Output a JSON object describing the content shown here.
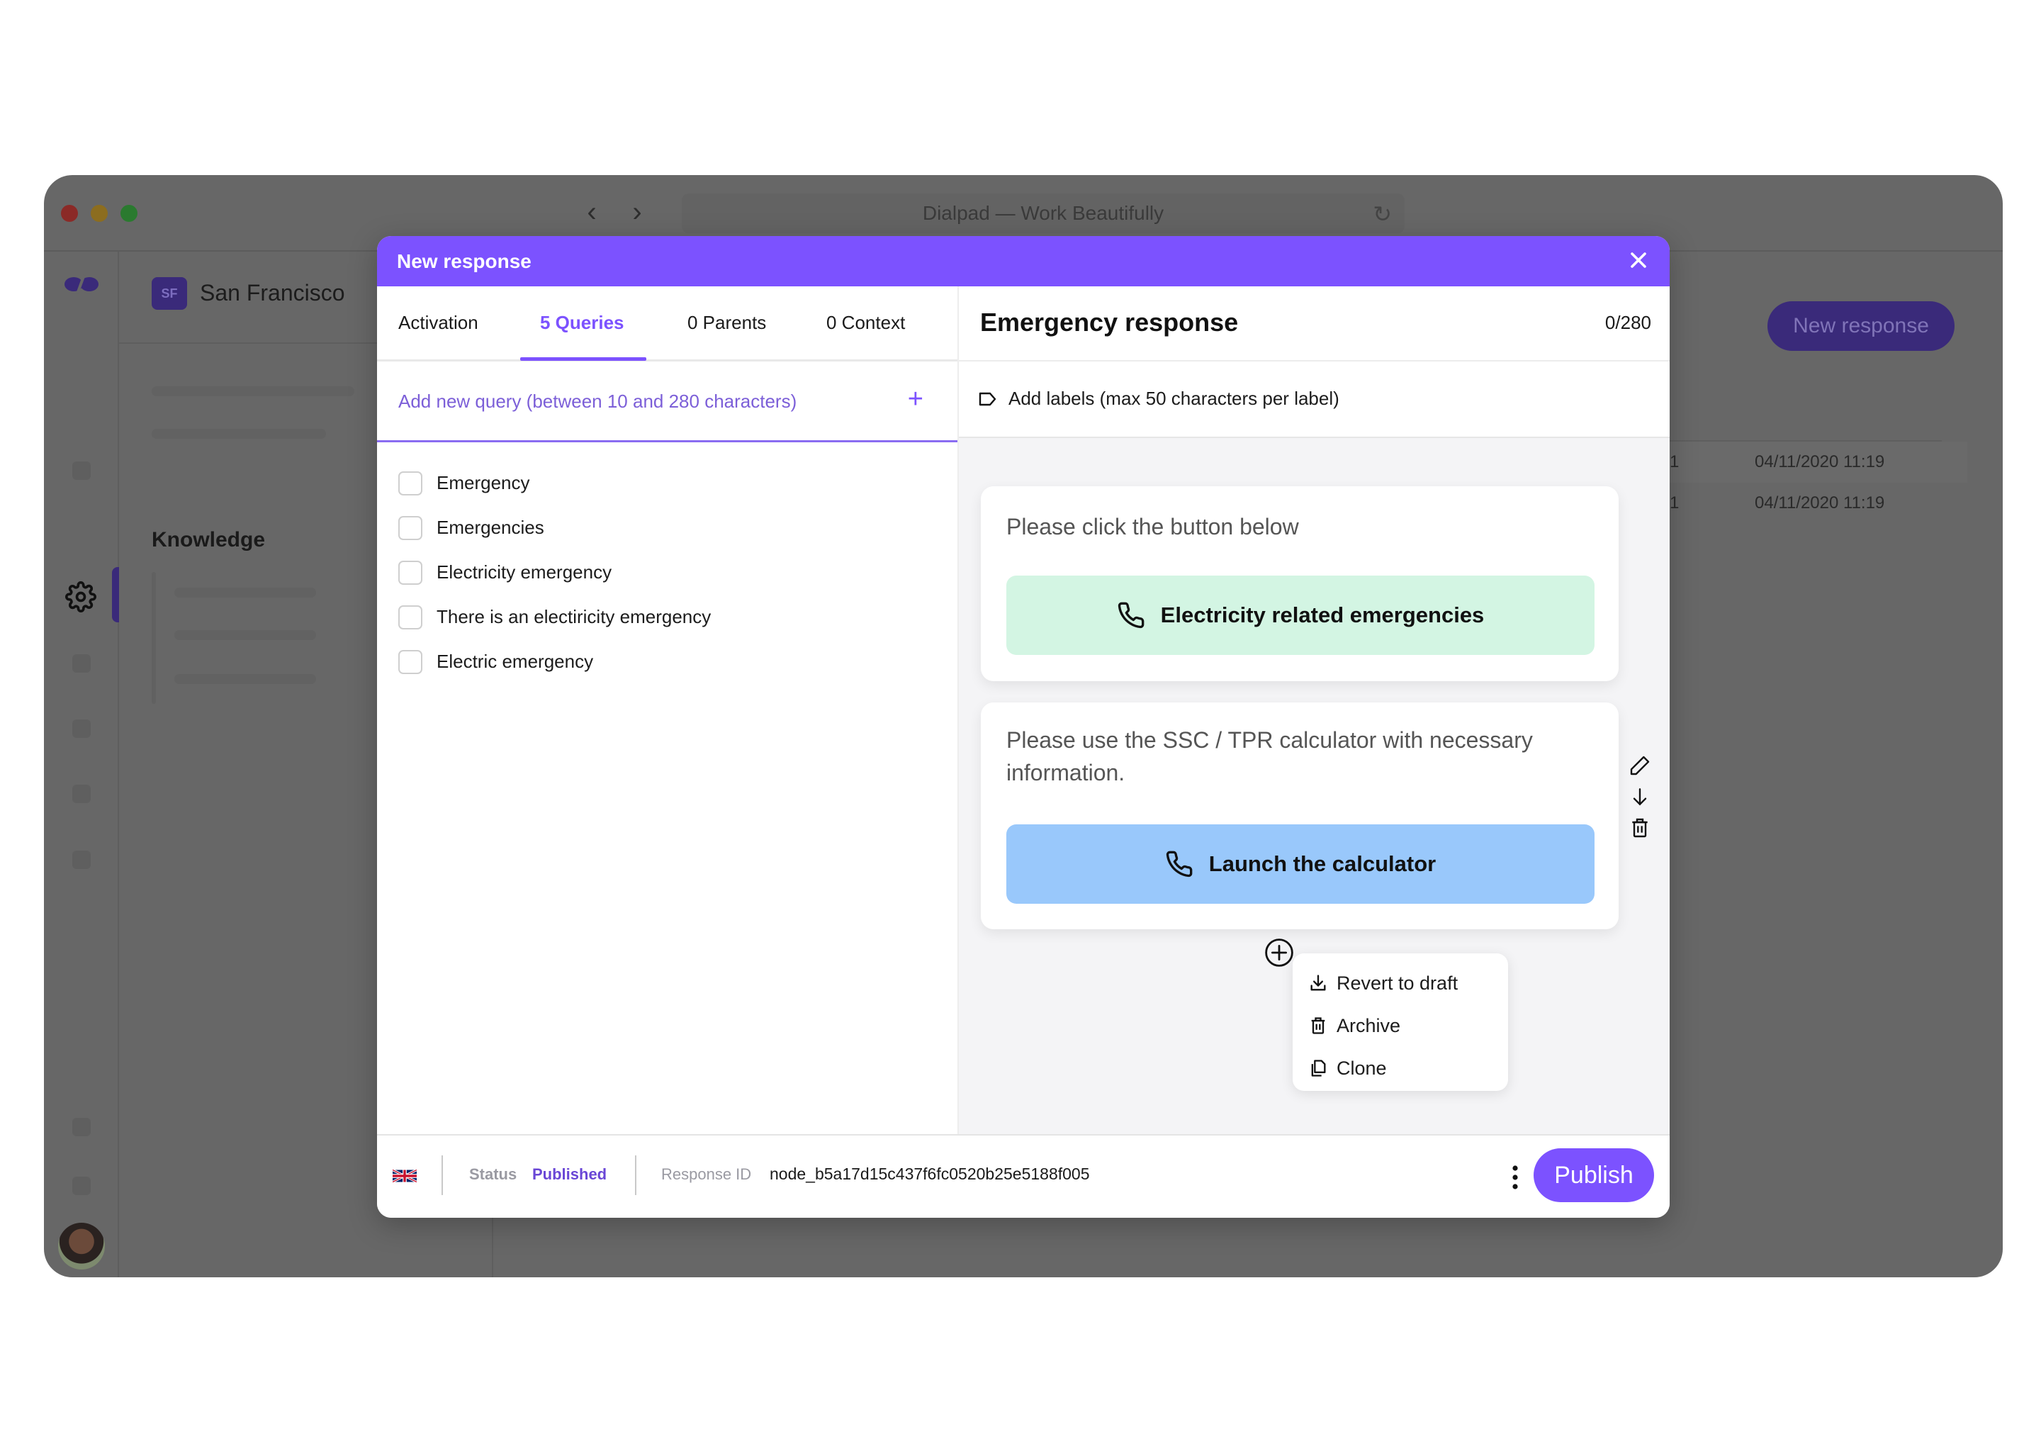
{
  "browser": {
    "url_title": "Dialpad — Work Beautifully",
    "traffic_lights": [
      "#8b2a27",
      "#8c6d1f",
      "#2a7a2f"
    ]
  },
  "app": {
    "workspace_badge": "SF",
    "workspace_name": "San Francisco",
    "section_title": "Knowledge",
    "new_response_button": "New response",
    "background_table": [
      {
        "count": "1",
        "date": "04/11/2020 11:19"
      },
      {
        "count": "1",
        "date": "04/11/2020 11:19"
      }
    ]
  },
  "modal": {
    "title": "New response",
    "accent_color": "#7c52ff",
    "tabs": [
      {
        "label": "Activation",
        "active": false
      },
      {
        "label": "5 Queries",
        "active": true
      },
      {
        "label": "0 Parents",
        "active": false
      },
      {
        "label": "0 Context",
        "active": false
      }
    ],
    "add_query_placeholder": "Add new query (between 10 and 280 characters)",
    "queries": [
      {
        "text": "Emergency",
        "checked": false
      },
      {
        "text": "Emergencies",
        "checked": false
      },
      {
        "text": "Electricity emergency",
        "checked": false
      },
      {
        "text": "There is an electiricity emergency",
        "checked": false
      },
      {
        "text": "Electric emergency",
        "checked": false
      }
    ],
    "response_title": "Emergency response",
    "char_count": "0/280",
    "labels_placeholder": "Add labels (max 50 characters per label)",
    "blocks": [
      {
        "text": "Please click the button below",
        "button_label": "Electricity related emergencies",
        "button_color": "#d3f5e3"
      },
      {
        "text": "Please use the SSC / TPR calculator with necessary information.",
        "button_label": "Launch the calculator",
        "button_color": "#99c8fb"
      }
    ],
    "context_menu": [
      {
        "icon": "download-icon",
        "label": "Revert to draft"
      },
      {
        "icon": "trash-icon",
        "label": "Archive"
      },
      {
        "icon": "copy-icon",
        "label": "Clone"
      }
    ],
    "footer": {
      "language": "en-GB",
      "status_label": "Status",
      "status_value": "Published",
      "response_id_label": "Response ID",
      "response_id_value": "node_b5a17d15c437f6fc0520b25e5188f005",
      "publish_label": "Publish"
    }
  }
}
